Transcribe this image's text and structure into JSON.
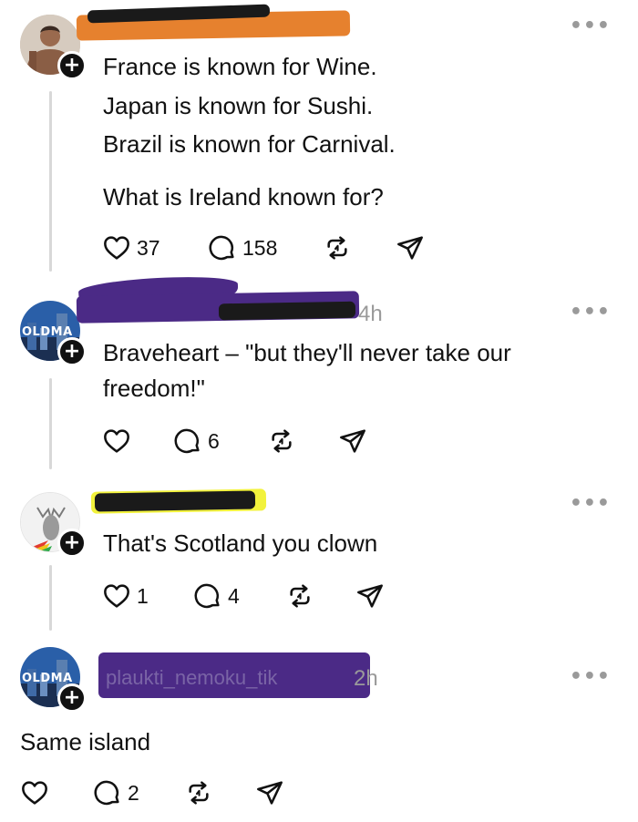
{
  "colors": {
    "redact_orange": "#e6812e",
    "redact_purple": "#4b2a86",
    "redact_yellow": "#f2f23c",
    "redact_black": "#1a1a1a"
  },
  "posts": [
    {
      "timestamp": "",
      "avatar_icon": "shirtless-man-avatar",
      "lines": [
        "France is known for Wine.",
        "Japan is known for Sushi.",
        "Brazil is known for Carnival.",
        "What is Ireland known for?"
      ],
      "likes": "37",
      "replies": "158"
    },
    {
      "timestamp": "4h",
      "avatar_icon": "oldman-city-avatar",
      "avatar_label": "OLDMA",
      "lines": [
        "Braveheart – \"but they'll never take our",
        "freedom!\""
      ],
      "likes": "",
      "replies": "6"
    },
    {
      "timestamp": "",
      "avatar_icon": "moose-avatar",
      "lines": [
        "That's Scotland you clown"
      ],
      "likes": "1",
      "replies": "4"
    },
    {
      "username_partial": "plaukti_nemoku_tik",
      "timestamp": "2h",
      "avatar_icon": "oldman-city-avatar",
      "avatar_label": "OLDMA",
      "lines": [
        "Same island"
      ],
      "likes": "",
      "replies": "2"
    }
  ]
}
